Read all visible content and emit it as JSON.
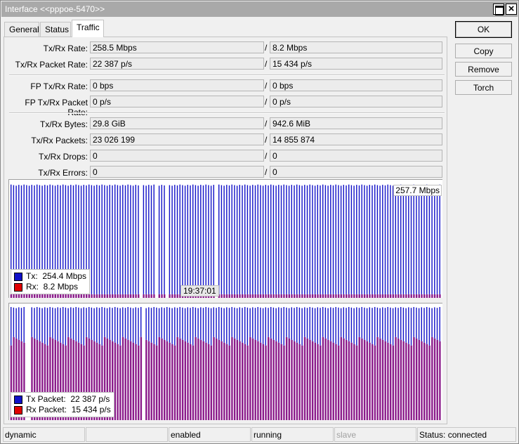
{
  "window": {
    "title": "Interface <<pppoe-5470>>"
  },
  "tabs": [
    {
      "label": "General"
    },
    {
      "label": "Status"
    },
    {
      "label": "Traffic"
    }
  ],
  "buttons": {
    "ok": "OK",
    "copy": "Copy",
    "remove": "Remove",
    "torch": "Torch"
  },
  "stats": {
    "txrx_rate": {
      "label": "Tx/Rx Rate:",
      "tx": "258.5 Mbps",
      "rx": "8.2 Mbps"
    },
    "txrx_packet_rate": {
      "label": "Tx/Rx Packet Rate:",
      "tx": "22 387 p/s",
      "rx": "15 434 p/s"
    },
    "fp_txrx_rate": {
      "label": "FP Tx/Rx Rate:",
      "tx": "0 bps",
      "rx": "0 bps"
    },
    "fp_txrx_packet_rate": {
      "label": "FP Tx/Rx Packet Rate:",
      "tx": "0 p/s",
      "rx": "0 p/s"
    },
    "txrx_bytes": {
      "label": "Tx/Rx Bytes:",
      "tx": "29.8 GiB",
      "rx": "942.6 MiB"
    },
    "txrx_packets": {
      "label": "Tx/Rx Packets:",
      "tx": "23 026 199",
      "rx": "14 855 874"
    },
    "txrx_drops": {
      "label": "Tx/Rx Drops:",
      "tx": "0",
      "rx": "0"
    },
    "txrx_errors": {
      "label": "Tx/Rx Errors:",
      "tx": "0",
      "rx": "0"
    },
    "separator": "/"
  },
  "graph_rate": {
    "peak_label": "257.7 Mbps",
    "time_label": "19:37:01",
    "legend": {
      "tx_label": "Tx:",
      "tx_value": "254.4 Mbps",
      "rx_label": "Rx:",
      "rx_value": "8.2 Mbps"
    },
    "colors": {
      "tx": "#1010c8",
      "rx": "#e00000",
      "overlap": "#8a1a8a"
    }
  },
  "graph_packets": {
    "legend": {
      "tx_label": "Tx Packet:",
      "tx_value": "22 387 p/s",
      "rx_label": "Rx Packet:",
      "rx_value": "15 434 p/s"
    },
    "colors": {
      "tx": "#1010c8",
      "rx": "#e00000",
      "overlap": "#8a1a8a"
    }
  },
  "statusbar": {
    "cells": [
      "dynamic",
      "",
      "enabled",
      "running",
      "slave",
      "Status: connected"
    ]
  }
}
